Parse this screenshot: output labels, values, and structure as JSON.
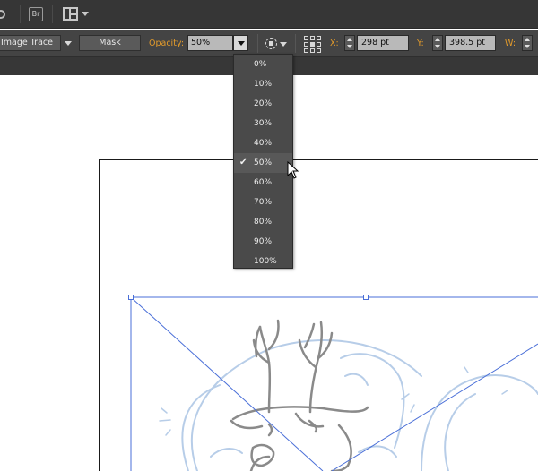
{
  "appbar": {
    "bridge_label": "Br"
  },
  "control_bar": {
    "image_trace_label": "Image Trace",
    "mask_label": "Mask",
    "opacity_label": "Opacity:",
    "opacity_value": "50%",
    "x_label": "X:",
    "x_value": "298 pt",
    "y_label": "Y:",
    "y_value": "398.5 pt",
    "w_label": "W:"
  },
  "opacity_menu": {
    "items": [
      "0%",
      "10%",
      "20%",
      "30%",
      "40%",
      "50%",
      "60%",
      "70%",
      "80%",
      "90%",
      "100%"
    ],
    "selected": "50%"
  },
  "colors": {
    "accent_label": "#e39b2b",
    "panel_bg": "#444444",
    "selection": "#4a6fd8"
  },
  "icons": {
    "bridge": "bridge-icon",
    "arrange": "arrange-documents-icon",
    "transform": "transform-icon",
    "reference_point": "reference-point-icon",
    "cursor": "cursor-arrow-icon",
    "check": "checkmark-icon"
  }
}
